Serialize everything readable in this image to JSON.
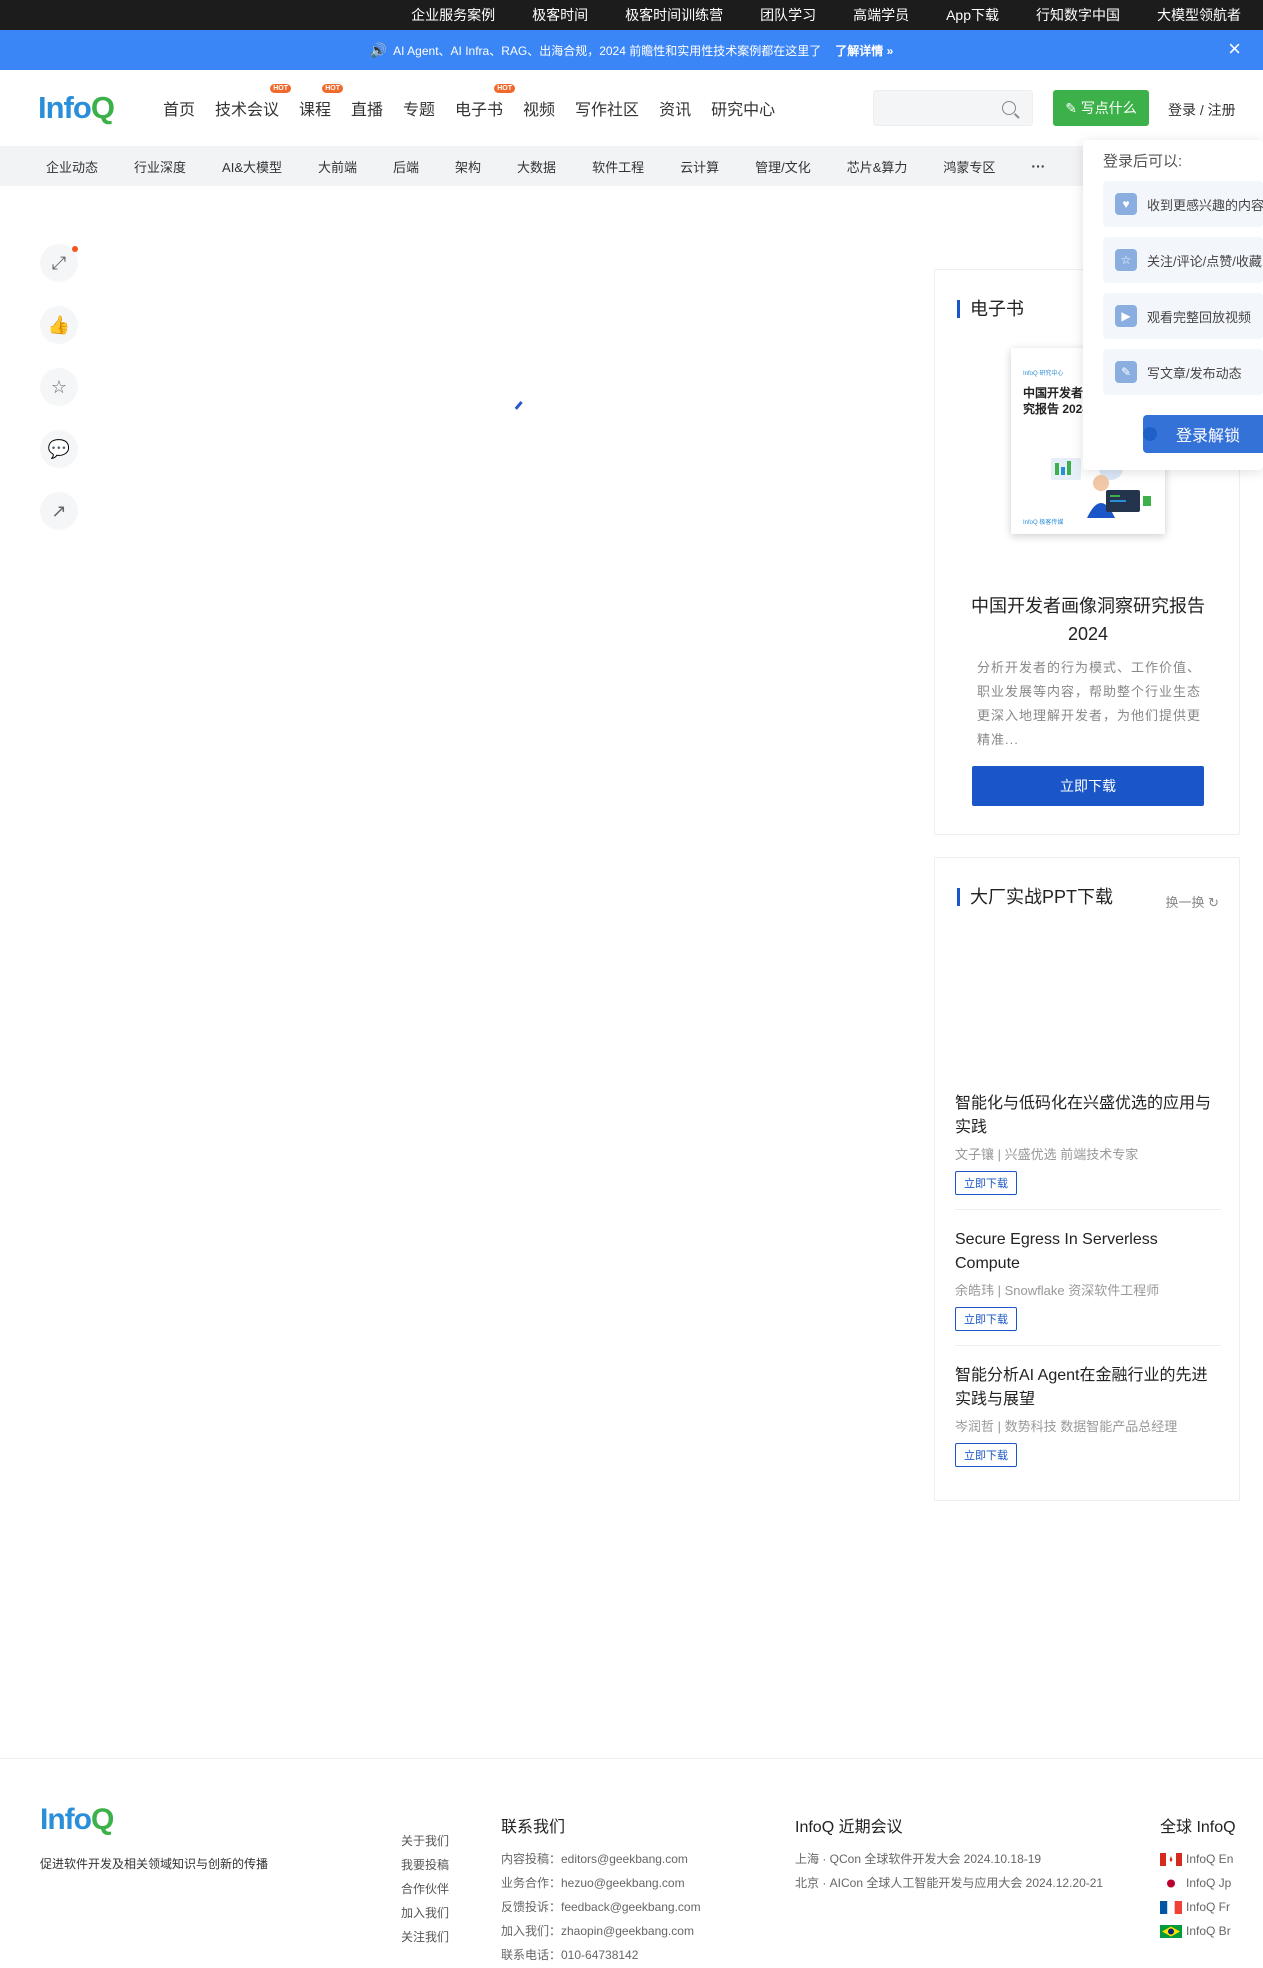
{
  "topbar": {
    "links": [
      "企业服务案例",
      "极客时间",
      "极客时间训练营",
      "团队学习",
      "高端学员",
      "App下载",
      "行知数字中国",
      "大模型领航者"
    ]
  },
  "notice": {
    "text": "AI Agent、AI Infra、RAG、出海合规，2024 前瞻性和实用性技术案例都在这里了",
    "more": "了解详情 »",
    "close": "×"
  },
  "header": {
    "logo_info": "Info",
    "logo_q": "Q",
    "nav": [
      {
        "label": "首页",
        "hot": ""
      },
      {
        "label": "技术会议",
        "hot": "HOT"
      },
      {
        "label": "课程",
        "hot": "HOT"
      },
      {
        "label": "直播",
        "hot": ""
      },
      {
        "label": "专题",
        "hot": ""
      },
      {
        "label": "电子书",
        "hot": "HOT"
      },
      {
        "label": "视频",
        "hot": ""
      },
      {
        "label": "写作社区",
        "hot": ""
      },
      {
        "label": "资讯",
        "hot": ""
      },
      {
        "label": "研究中心",
        "hot": ""
      }
    ],
    "search_placeholder": "",
    "write_label": "写点什么",
    "login_label": "登录 / 注册"
  },
  "subnav": [
    "企业动态",
    "行业深度",
    "AI&大模型",
    "大前端",
    "后端",
    "架构",
    "大数据",
    "软件工程",
    "云计算",
    "管理/文化",
    "芯片&算力",
    "鸿蒙专区",
    "···"
  ],
  "login_panel": {
    "title": "登录后可以:",
    "items": [
      "收到更感兴趣的内容",
      "关注/评论/点赞/收藏",
      "观看完整回放视频",
      "写文章/发布动态"
    ],
    "button": "登录解锁"
  },
  "ebook": {
    "section_title": "电子书",
    "cover_brand": "InfoQ 研究中心",
    "cover_title": "中国开发者画像洞察研究报告 2024",
    "cover_foot": "InfoQ 极客传媒",
    "name": "中国开发者画像洞察研究报告2024",
    "desc": "分析开发者的行为模式、工作价值、职业发展等内容，帮助整个行业生态更深入地理解开发者，为他们提供更精准...",
    "button": "立即下载"
  },
  "ppt": {
    "section_title": "大厂实战PPT下载",
    "refresh": "换一换 ↻",
    "items": [
      {
        "title": "智能化与低码化在兴盛优选的应用与实践",
        "author": "文子镶 | 兴盛优选 前端技术专家",
        "button": "立即下载"
      },
      {
        "title": "Secure Egress In Serverless Compute",
        "author": "余皓玮 | Snowflake 资深软件工程师",
        "button": "立即下载"
      },
      {
        "title": "智能分析AI Agent在金融行业的先进实践与展望",
        "author": "岑润哲 | 数势科技 数据智能产品总经理",
        "button": "立即下载"
      }
    ]
  },
  "footer": {
    "logo_info": "Info",
    "logo_q": "Q",
    "slogan": "促进软件开发及相关领域知识与创新的传播",
    "links": [
      "关于我们",
      "我要投稿",
      "合作伙伴",
      "加入我们",
      "关注我们"
    ],
    "contact": {
      "title": "联系我们",
      "lines": [
        "内容投稿：editors@geekbang.com",
        "业务合作：hezuo@geekbang.com",
        "反馈投诉：feedback@geekbang.com",
        "加入我们：zhaopin@geekbang.com",
        "联系电话：010-64738142"
      ]
    },
    "conferences": {
      "title": "InfoQ 近期会议",
      "lines": [
        "上海 · QCon 全球软件开发大会 2024.10.18-19",
        "北京 · AICon 全球人工智能开发与应用大会 2024.12.20-21"
      ]
    },
    "global": {
      "title": "全球 InfoQ",
      "sites": [
        "InfoQ En",
        "InfoQ Jp",
        "InfoQ Fr",
        "InfoQ Br"
      ]
    }
  }
}
